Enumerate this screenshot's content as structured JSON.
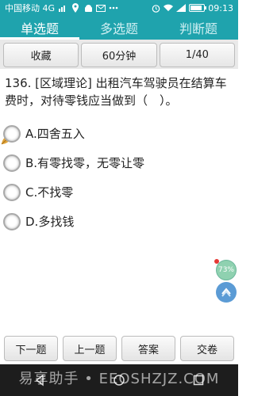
{
  "status_bar": {
    "carrier": "中国移动 4G",
    "time": "09:13",
    "battery_level": 0.9,
    "icons": [
      "signal-icon",
      "location-icon",
      "android-icon",
      "mail-icon",
      "more-icon",
      "alarm-icon",
      "wifi-icon",
      "cell-signal-icon",
      "battery-icon"
    ]
  },
  "tabs": [
    {
      "label": "单选题",
      "active": true
    },
    {
      "label": "多选题",
      "active": false
    },
    {
      "label": "判断题",
      "active": false
    }
  ],
  "toolbar": {
    "favorite_label": "收藏",
    "timer_label": "60分钟",
    "progress_label": "1/40"
  },
  "question": {
    "text": "136. [区域理论] 出租汽车驾驶员在结算车费时，对待零钱应当做到（　）。"
  },
  "options": [
    {
      "label": "A.四舍五入"
    },
    {
      "label": "B.有零找零，无零让零"
    },
    {
      "label": "C.不找零"
    },
    {
      "label": "D.多找钱"
    }
  ],
  "floating": {
    "speed_percent": "73%"
  },
  "bottom_buttons": {
    "prev_next": "下一题",
    "prev": "上一题",
    "answer": "答案",
    "submit": "交卷"
  },
  "watermark": "易享助手 • EEOSHZJZ.COM",
  "colors": {
    "accent": "#1fa3ad"
  }
}
